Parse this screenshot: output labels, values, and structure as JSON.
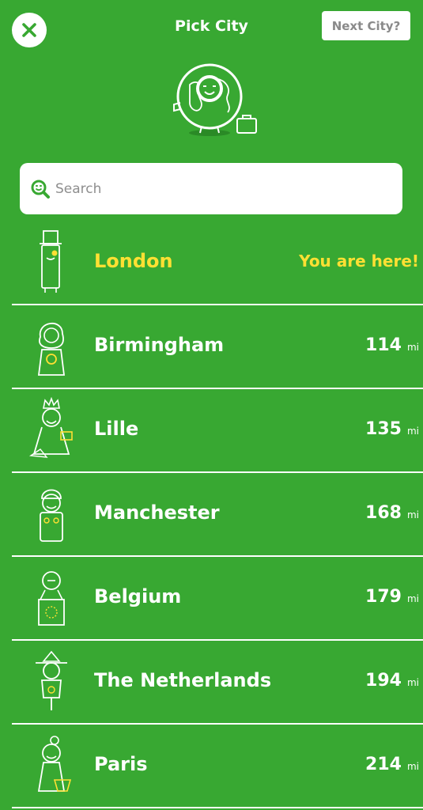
{
  "header": {
    "title": "Pick City",
    "next_label": "Next City?"
  },
  "search": {
    "placeholder": "Search",
    "icon": "smiley-magnifier-icon"
  },
  "colors": {
    "background": "#38a832",
    "highlight": "#ffe033",
    "text": "#ffffff"
  },
  "current_city": {
    "name": "London",
    "status": "You are here!",
    "icon": "top-hat-guard-icon"
  },
  "cities": [
    {
      "name": "Birmingham",
      "distance": "114",
      "unit": "mi",
      "icon": "curly-hair-person-icon"
    },
    {
      "name": "Lille",
      "distance": "135",
      "unit": "mi",
      "icon": "queen-with-crown-icon"
    },
    {
      "name": "Manchester",
      "distance": "168",
      "unit": "mi",
      "icon": "fan-person-icon"
    },
    {
      "name": "Belgium",
      "distance": "179",
      "unit": "mi",
      "icon": "podium-person-icon"
    },
    {
      "name": "The Netherlands",
      "distance": "194",
      "unit": "mi",
      "icon": "cyclist-hat-icon"
    },
    {
      "name": "Paris",
      "distance": "214",
      "unit": "mi",
      "icon": "basket-woman-icon"
    }
  ]
}
